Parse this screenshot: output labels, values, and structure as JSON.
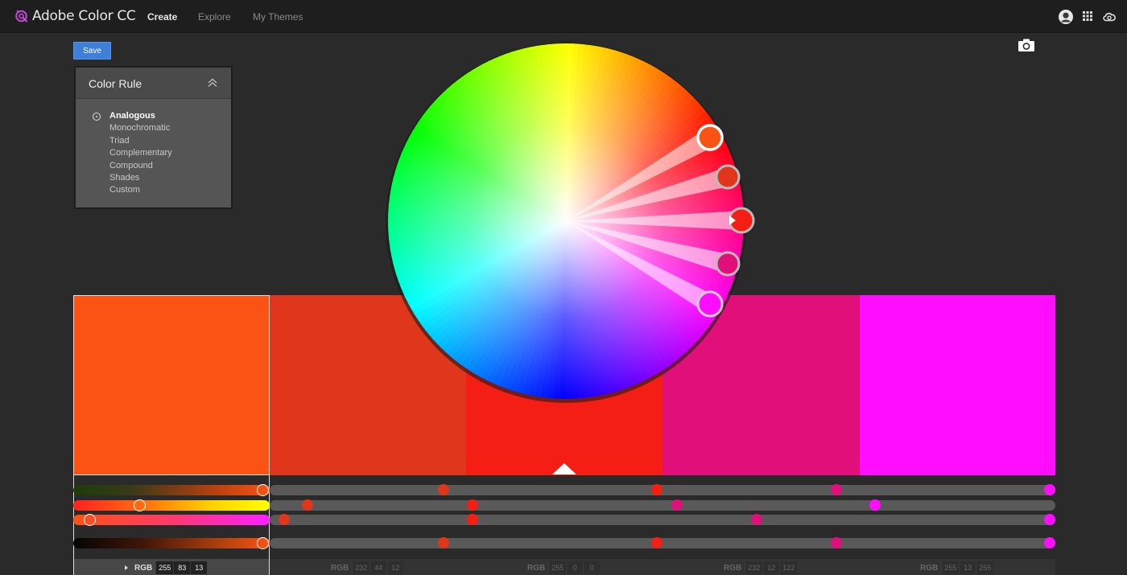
{
  "app": {
    "title": "Adobe Color CC"
  },
  "nav": {
    "items": [
      "Create",
      "Explore",
      "My Themes"
    ],
    "active": "Create"
  },
  "toolbar": {
    "save_label": "Save"
  },
  "color_rule": {
    "title": "Color Rule",
    "options": [
      "Analogous",
      "Monochromatic",
      "Triad",
      "Complementary",
      "Compound",
      "Shades",
      "Custom"
    ],
    "selected": "Analogous"
  },
  "swatches": [
    {
      "hex": "#FB5314",
      "rgb": [
        "255",
        "83",
        "13"
      ],
      "mode": "RGB",
      "selected": true
    },
    {
      "hex": "#E0361B",
      "rgb": [
        "232",
        "44",
        "12"
      ],
      "mode": "RGB",
      "selected": false
    },
    {
      "hex": "#F51E14",
      "rgb": [
        "255",
        "0",
        "0"
      ],
      "mode": "RGB",
      "selected": false
    },
    {
      "hex": "#E00F7A",
      "rgb": [
        "232",
        "12",
        "122"
      ],
      "mode": "RGB",
      "selected": false
    },
    {
      "hex": "#FF0DFF",
      "rgb": [
        "255",
        "13",
        "255"
      ],
      "mode": "RGB",
      "selected": false
    }
  ],
  "colors": {
    "background": "#2a2a2a",
    "topbar": "#1e1e1e",
    "accent": "#3e80d9"
  },
  "icons": [
    "adobe-color-logo-icon",
    "user-avatar-icon",
    "app-grid-icon",
    "creative-cloud-icon",
    "camera-icon",
    "collapse-chevron-icon",
    "radio-icon"
  ]
}
